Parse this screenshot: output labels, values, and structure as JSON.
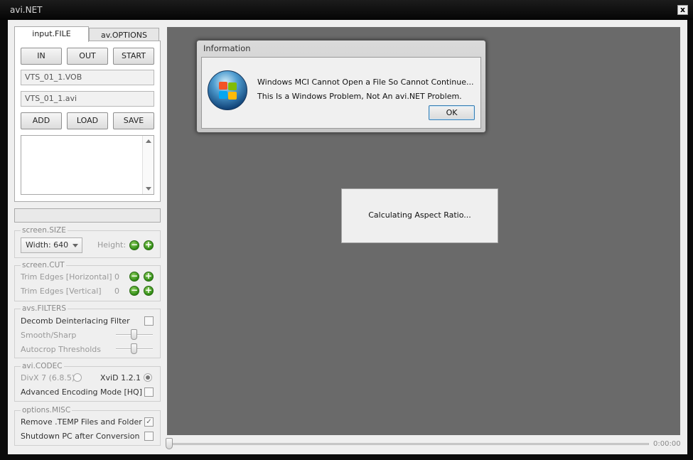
{
  "window": {
    "title": "avi.NET",
    "close_glyph": "x"
  },
  "tabs": [
    {
      "label": "input.FILE",
      "active": true
    },
    {
      "label": "av.OPTIONS",
      "active": false
    }
  ],
  "input": {
    "in_label": "IN",
    "out_label": "OUT",
    "start_label": "START",
    "source_file": "VTS_01_1.VOB",
    "output_file": "VTS_01_1.avi",
    "add_label": "ADD",
    "load_label": "LOAD",
    "save_label": "SAVE"
  },
  "screen_size": {
    "title": "screen.SIZE",
    "width_value": "Width: 640",
    "height_label": "Height:",
    "minus": "−",
    "plus": "+"
  },
  "screen_cut": {
    "title": "screen.CUT",
    "horizontal_label": "Trim Edges [Horizontal]",
    "horizontal_value": "0",
    "vertical_label": "Trim Edges [Vertical]",
    "vertical_value": "0"
  },
  "filters": {
    "title": "avs.FILTERS",
    "decomb_label": "Decomb Deinterlacing Filter",
    "smooth_label": "Smooth/Sharp",
    "autocrop_label": "Autocrop Thresholds"
  },
  "codec": {
    "title": "avi.CODEC",
    "divx_label": "DivX 7 (6.8.5)",
    "xvid_label": "XviD 1.2.1",
    "selected": "XviD 1.2.1",
    "advanced_label": "Advanced Encoding Mode [HQ]"
  },
  "misc": {
    "title": "options.MISC",
    "remove_temp_label": "Remove .TEMP Files and Folder",
    "remove_temp_checked": "✓",
    "shutdown_label": "Shutdown PC after Conversion"
  },
  "player": {
    "timecode": "0:00:00",
    "position": 0
  },
  "info_dialog": {
    "title": "Information",
    "line1": "Windows MCI Cannot Open a File So Cannot Continue...",
    "line2": "This Is a Windows Problem, Not An avi.NET Problem.",
    "ok_label": "OK",
    "icon": "windows-logo-icon"
  },
  "status_box": {
    "text": "Calculating Aspect Ratio..."
  }
}
